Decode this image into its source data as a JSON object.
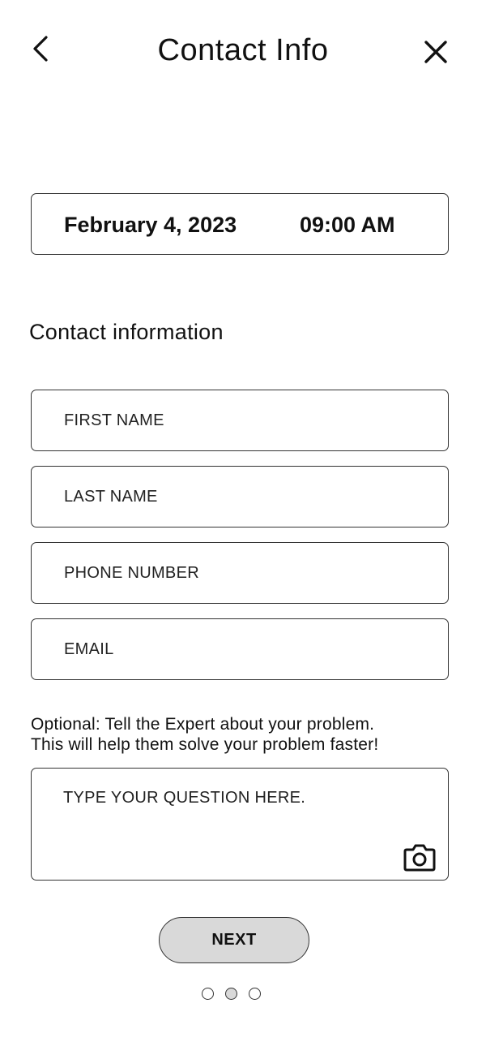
{
  "header": {
    "title": "Contact Info",
    "back_icon": "chevron-left-icon",
    "close_icon": "close-icon"
  },
  "appointment": {
    "date": "February 4, 2023",
    "time": "09:00 AM"
  },
  "contact_section": {
    "heading": "Contact information",
    "fields": {
      "first_name": {
        "placeholder": "FIRST NAME",
        "value": ""
      },
      "last_name": {
        "placeholder": "LAST NAME",
        "value": ""
      },
      "phone": {
        "placeholder": "PHONE NUMBER",
        "value": ""
      },
      "email": {
        "placeholder": "EMAIL",
        "value": ""
      }
    }
  },
  "question": {
    "note_line1": "Optional: Tell the Expert about your problem.",
    "note_line2": "This will help them solve your problem faster!",
    "placeholder": "TYPE YOUR QUESTION HERE.",
    "value": "",
    "attach_icon": "camera-icon"
  },
  "footer": {
    "next_label": "NEXT",
    "pager": {
      "total": 3,
      "current": 2
    }
  }
}
